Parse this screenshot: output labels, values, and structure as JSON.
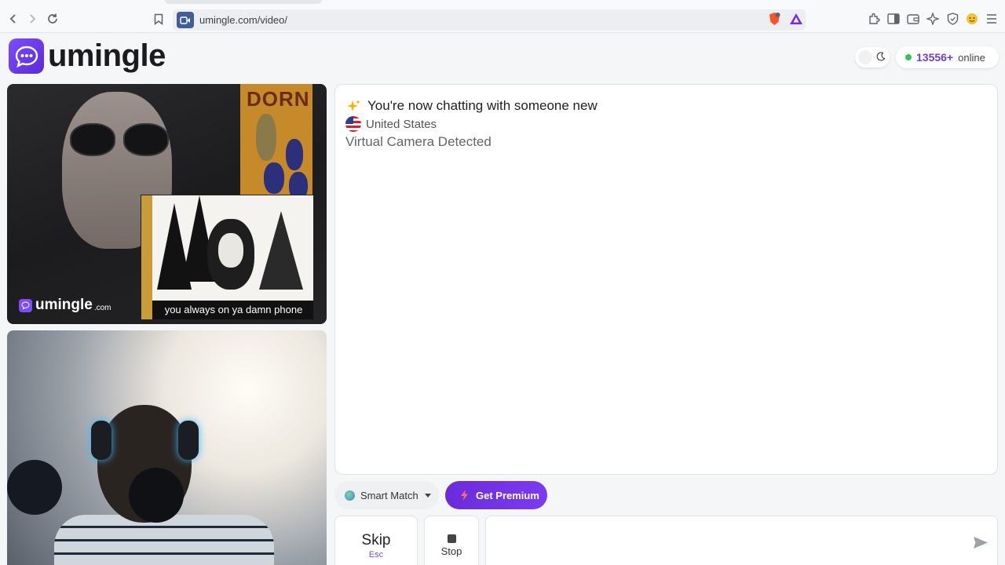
{
  "browser": {
    "url": "umingle.com/video/"
  },
  "header": {
    "logo_text": "umingle",
    "online_count": "13556+",
    "online_label": "online"
  },
  "remote_video": {
    "watermark_text": "umingle",
    "watermark_suffix": ".com",
    "poster_text": "DORN",
    "meme_caption": "you always on ya damn phone"
  },
  "chat": {
    "headline": "You're now chatting with someone new",
    "country": "United States",
    "status": "Virtual Camera Detected"
  },
  "controls": {
    "smart_match_label": "Smart Match",
    "premium_label": "Get Premium",
    "skip_label": "Skip",
    "skip_key": "Esc",
    "stop_label": "Stop",
    "message_placeholder": ""
  },
  "colors": {
    "brand": "#7c4dff",
    "premium": "#6a2bd9",
    "online_dot": "#36c25a"
  }
}
